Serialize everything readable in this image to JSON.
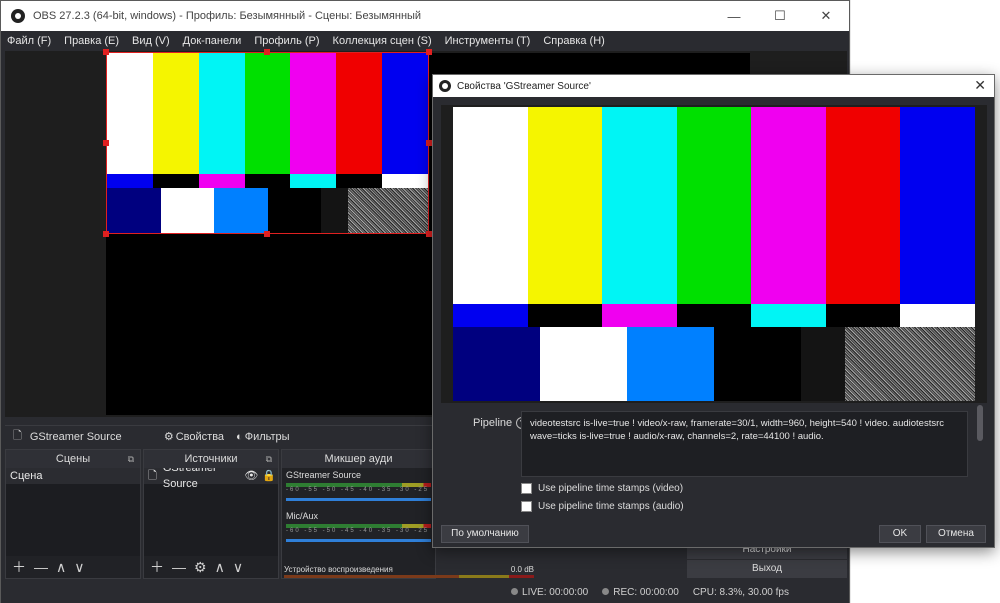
{
  "window": {
    "title": "OBS 27.2.3 (64-bit, windows) - Профиль: Безымянный - Сцены: Безымянный",
    "min": "—",
    "max": "☐",
    "close": "✕"
  },
  "menu": [
    "Файл (F)",
    "Правка (E)",
    "Вид (V)",
    "Док-панели",
    "Профиль (P)",
    "Коллекция сцен (S)",
    "Инструменты (T)",
    "Справка (H)"
  ],
  "source_toolbar": {
    "source_name": "GStreamer Source",
    "properties": "Свойства",
    "filters": "Фильтры"
  },
  "scenes": {
    "header": "Сцены",
    "items": [
      "Сцена"
    ]
  },
  "sources": {
    "header": "Источники",
    "items": [
      "GStreamer Source"
    ]
  },
  "mixer": {
    "header": "Микшер ауди",
    "channels": [
      {
        "name": "GStreamer Source"
      },
      {
        "name": "Mic/Aux"
      },
      {
        "name": "Устройство воспроизведения",
        "db": "0.0 dB"
      }
    ],
    "scale": "-60 -55 -50 -45 -40 -35 -30 -25"
  },
  "controls": {
    "settings": "Настройки",
    "exit": "Выход"
  },
  "status": {
    "live": "LIVE: 00:00:00",
    "rec": "REC: 00:00:00",
    "cpu": "CPU: 8.3%, 30.00 fps"
  },
  "dialog": {
    "title": "Свойства 'GStreamer Source'",
    "close": "✕",
    "pipeline_label": "Pipeline",
    "pipeline_value": "videotestsrc is-live=true ! video/x-raw, framerate=30/1, width=960, height=540 ! video. audiotestsrc wave=ticks is-live=true ! audio/x-raw, channels=2, rate=44100 ! audio.",
    "checkbox_video": "Use pipeline time stamps (video)",
    "checkbox_audio": "Use pipeline time stamps (audio)",
    "defaults": "По умолчанию",
    "ok": "OK",
    "cancel": "Отмена"
  },
  "colors": {
    "bars_top": [
      "#ffffff",
      "#f5f500",
      "#00f5f5",
      "#00e000",
      "#f000f0",
      "#f00000",
      "#0000f0"
    ],
    "bars_mid": [
      "#0000f0",
      "#000000",
      "#f000f0",
      "#000000",
      "#00f5f5",
      "#000000",
      "#ffffff"
    ],
    "bars_bottom": [
      "#00007f",
      "#ffffff",
      "#0080ff",
      "#000000",
      "#141414",
      "noise"
    ]
  }
}
